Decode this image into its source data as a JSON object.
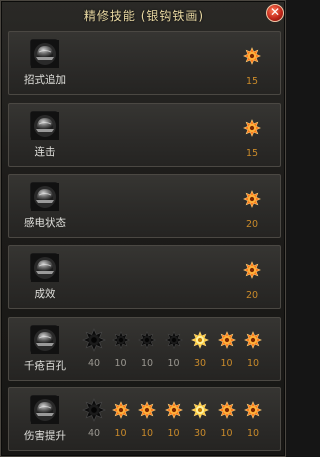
{
  "window": {
    "title": "精修技能 (银钩铁画)"
  },
  "skills": [
    {
      "name": "招式追加",
      "stars": [
        {
          "state": "lit",
          "value": "15"
        }
      ]
    },
    {
      "name": "连击",
      "stars": [
        {
          "state": "lit",
          "value": "15"
        }
      ]
    },
    {
      "name": "感电状态",
      "stars": [
        {
          "state": "lit",
          "value": "20"
        }
      ]
    },
    {
      "name": "成效",
      "stars": [
        {
          "state": "lit",
          "value": "20"
        }
      ]
    },
    {
      "name": "千疮百孔",
      "stars": [
        {
          "state": "dark-big",
          "value": "40"
        },
        {
          "state": "dark",
          "value": "10"
        },
        {
          "state": "dark",
          "value": "10"
        },
        {
          "state": "dark",
          "value": "10"
        },
        {
          "state": "gold",
          "value": "30"
        },
        {
          "state": "orange",
          "value": "10"
        },
        {
          "state": "orange",
          "value": "10"
        }
      ]
    },
    {
      "name": "伤害提升",
      "stars": [
        {
          "state": "dark-big",
          "value": "40"
        },
        {
          "state": "orange",
          "value": "10"
        },
        {
          "state": "orange",
          "value": "10"
        },
        {
          "state": "orange",
          "value": "10"
        },
        {
          "state": "gold",
          "value": "30"
        },
        {
          "state": "orange",
          "value": "10"
        },
        {
          "state": "orange",
          "value": "10"
        }
      ]
    }
  ],
  "colors": {
    "value_text": "#c98a2a",
    "value_text_inactive": "#9a9790",
    "title_text": "#e9d9a3"
  },
  "icons": {
    "close": "close-icon",
    "skill": "helmet-icon",
    "star": "spiked-star-icon"
  }
}
